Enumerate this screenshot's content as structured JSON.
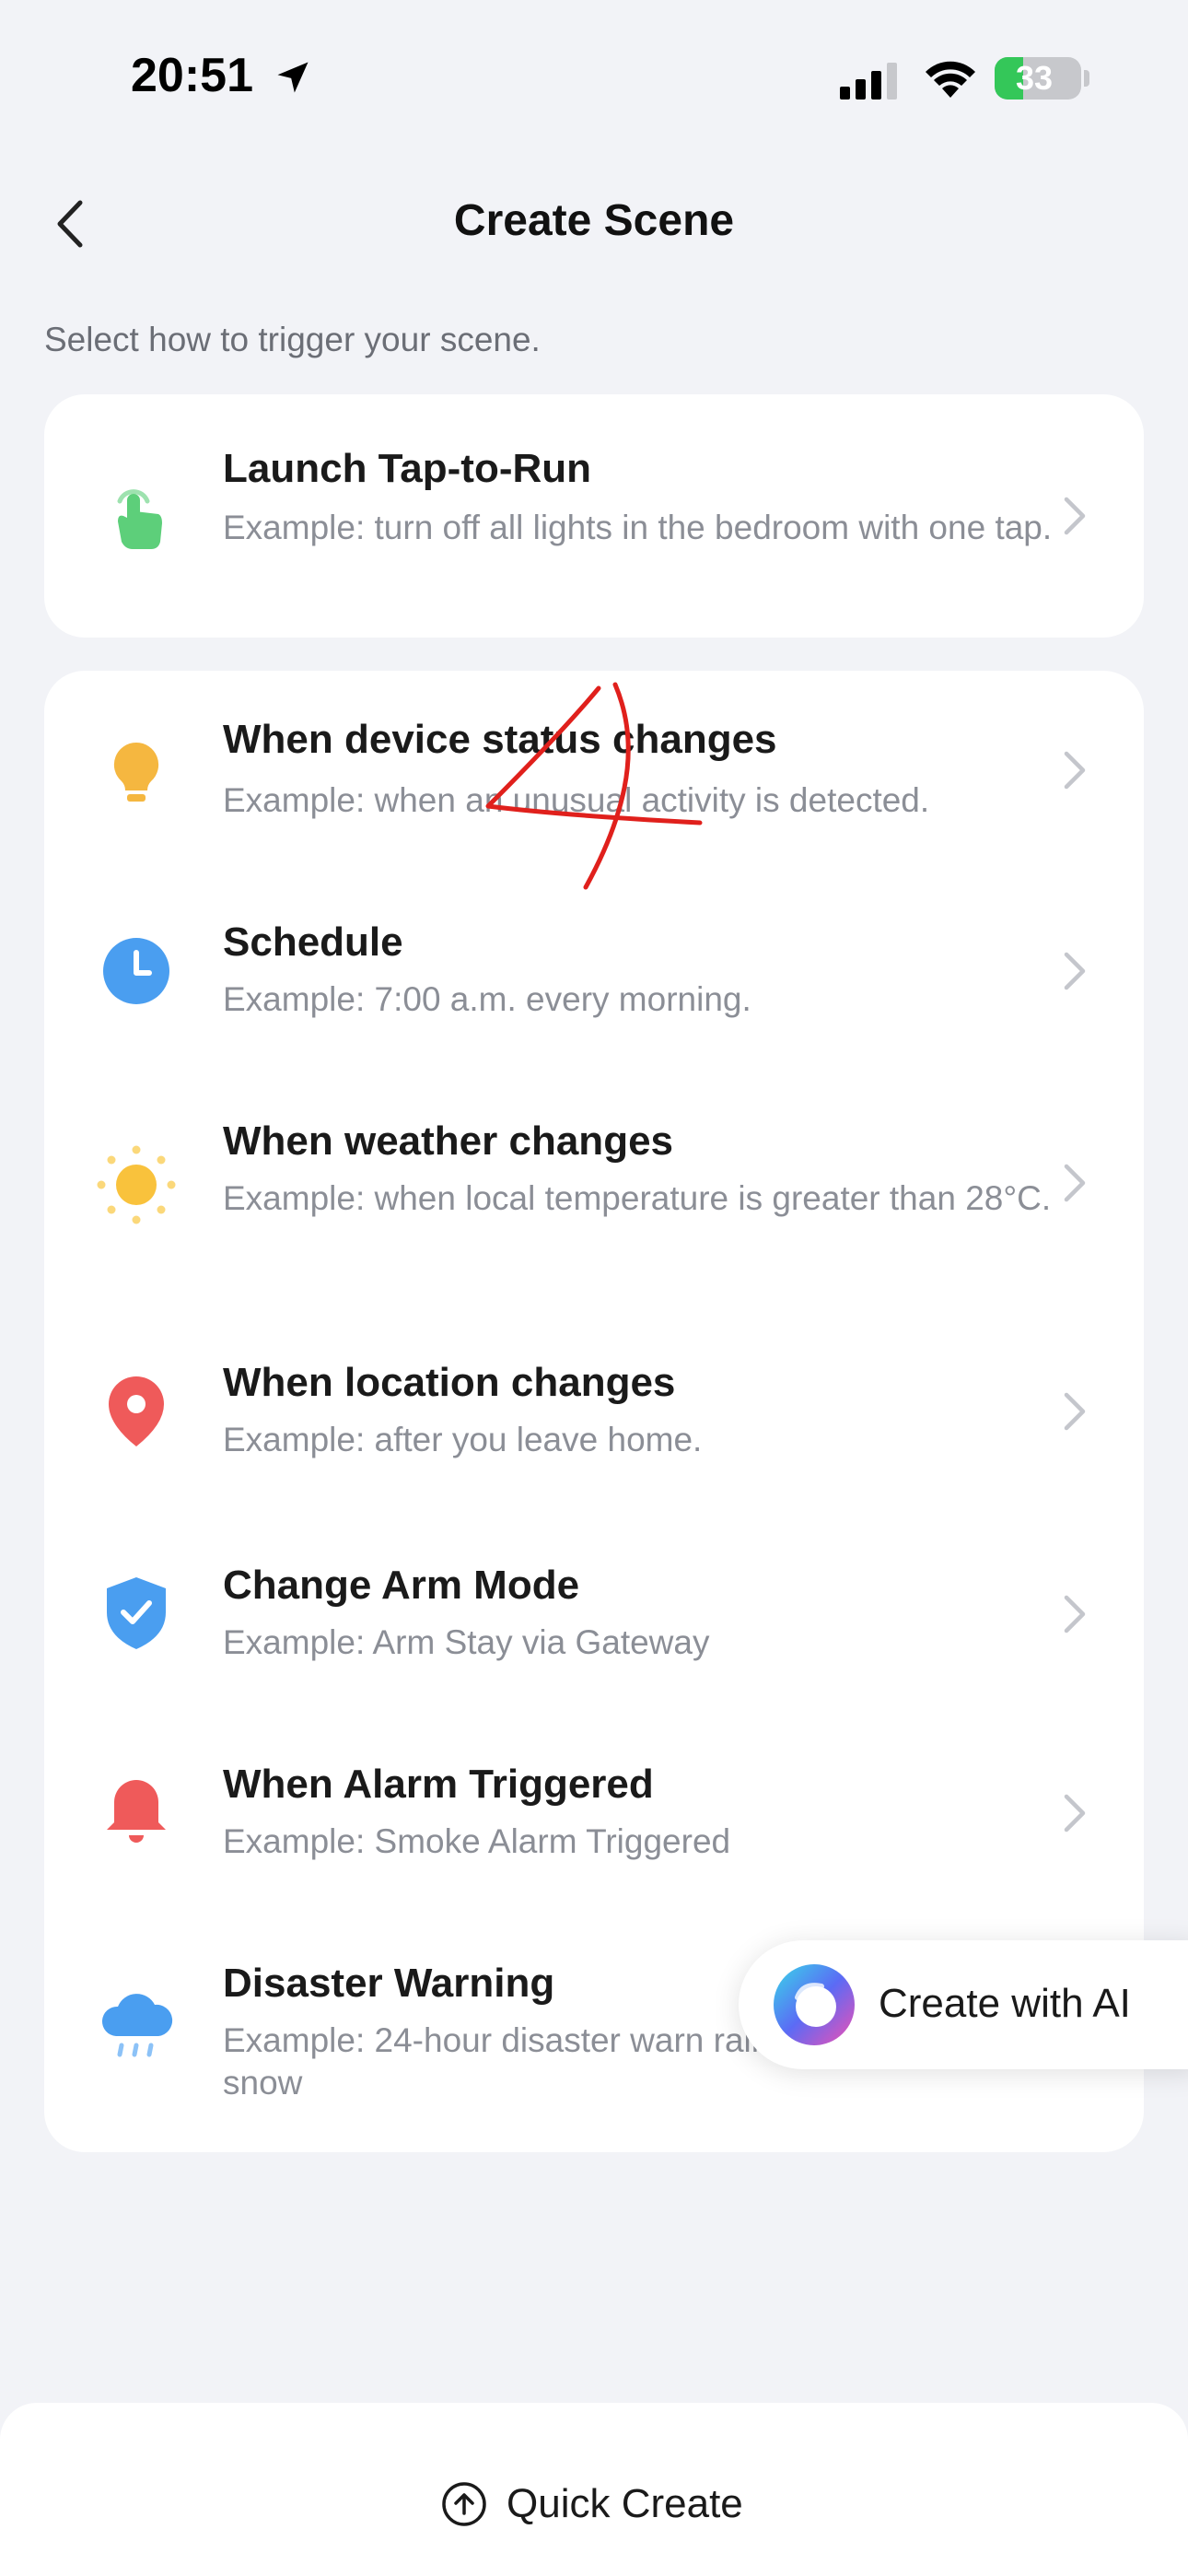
{
  "status_bar": {
    "time": "20:51",
    "battery_percent": "33",
    "battery_level": 0.33
  },
  "header": {
    "title": "Create Scene",
    "back_icon": "chevron-left-icon"
  },
  "subtitle": "Select how to trigger your scene.",
  "tap_to_run": {
    "title": "Launch Tap-to-Run",
    "description": "Example: turn off all lights in the bedroom with one tap.",
    "icon": "tap-hand-icon",
    "icon_color": "#5dcf7a"
  },
  "triggers": [
    {
      "title": "When device status changes",
      "description": "Example: when an unusual activity is detected.",
      "icon": "lightbulb-icon",
      "icon_color": "#f5b740"
    },
    {
      "title": "Schedule",
      "description": "Example: 7:00 a.m. every morning.",
      "icon": "clock-icon",
      "icon_color": "#4a9ef0"
    },
    {
      "title": "When weather changes",
      "description": "Example: when local temperature is greater than 28°C.",
      "icon": "sun-icon",
      "icon_color": "#f9c23c"
    },
    {
      "title": "When location changes",
      "description": "Example: after you leave home.",
      "icon": "location-pin-icon",
      "icon_color": "#ef5a5a"
    },
    {
      "title": "Change Arm Mode",
      "description": "Example: Arm Stay via Gateway",
      "icon": "shield-check-icon",
      "icon_color": "#4a9ef0"
    },
    {
      "title": "When Alarm Triggered",
      "description": "Example: Smoke Alarm Triggered",
      "icon": "bell-icon",
      "icon_color": "#ef5a5a"
    },
    {
      "title": "Disaster Warning",
      "description": "Example: 24-hour disaster warn rain and snow",
      "icon": "rain-cloud-icon",
      "icon_color": "#4a9ef0"
    }
  ],
  "ai_button": {
    "label": "Create with AI"
  },
  "bottom_bar": {
    "quick_create_label": "Quick Create"
  },
  "colors": {
    "background": "#f2f3f7",
    "card": "#ffffff",
    "annotation": "#e0201c",
    "chevron": "#c4c6cc"
  }
}
